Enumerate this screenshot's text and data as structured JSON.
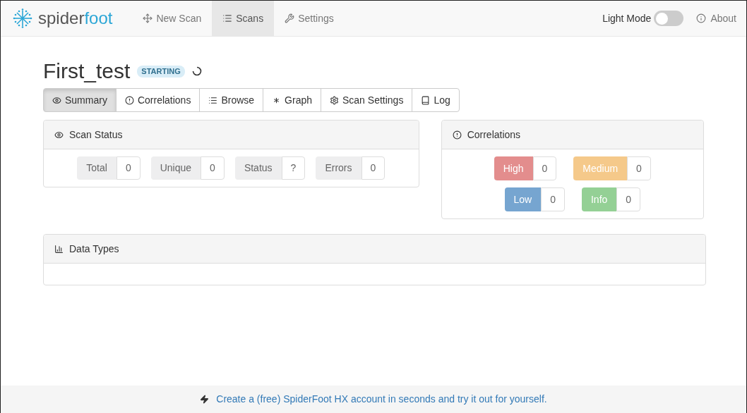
{
  "navbar": {
    "logo": {
      "first": "spider",
      "second": "foot"
    },
    "items": [
      {
        "label": "New Scan",
        "selected": false
      },
      {
        "label": "Scans",
        "selected": true
      },
      {
        "label": "Settings",
        "selected": false
      }
    ],
    "light_mode": {
      "label": "Light Mode",
      "on": false
    },
    "about": "About"
  },
  "scan": {
    "title": "First_test",
    "status": "STARTING"
  },
  "tabs": [
    {
      "label": "Summary",
      "selected": true
    },
    {
      "label": "Correlations",
      "selected": false
    },
    {
      "label": "Browse",
      "selected": false
    },
    {
      "label": "Graph",
      "selected": false
    },
    {
      "label": "Scan Settings",
      "selected": false
    },
    {
      "label": "Log",
      "selected": false
    }
  ],
  "scan_status": {
    "title": "Scan Status",
    "stats": [
      {
        "label": "Total",
        "value": "0"
      },
      {
        "label": "Unique",
        "value": "0"
      },
      {
        "label": "Status",
        "value": "?"
      },
      {
        "label": "Errors",
        "value": "0"
      }
    ]
  },
  "correlations": {
    "title": "Correlations",
    "items": [
      {
        "label": "High",
        "value": "0",
        "color": "#e38d8d"
      },
      {
        "label": "Medium",
        "value": "0",
        "color": "#f5c98a"
      },
      {
        "label": "Low",
        "value": "0",
        "color": "#76a5d0"
      },
      {
        "label": "Info",
        "value": "0",
        "color": "#94d095"
      }
    ]
  },
  "data_types": {
    "title": "Data Types"
  },
  "footer": {
    "link": "Create a (free) SpiderFoot HX account in seconds and try it out for yourself."
  }
}
